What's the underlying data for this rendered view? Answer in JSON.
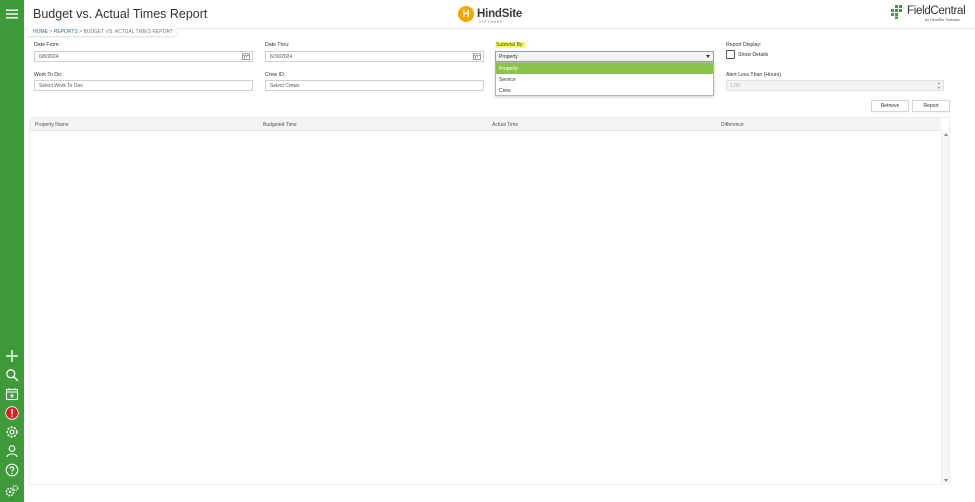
{
  "header": {
    "title": "Budget vs. Actual Times Report",
    "brand_center": {
      "name": "HindSite",
      "mark": "H",
      "sub": "SOFTWARE"
    },
    "brand_right": {
      "name": "FieldCentral",
      "sub": "by HindSite Software"
    }
  },
  "breadcrumb": {
    "home": "HOME",
    "sep1": " > ",
    "reports": "REPORTS",
    "sep2": " > ",
    "current": "BUDGET VS. ACTUAL TIMES REPORT"
  },
  "form": {
    "date_from": {
      "label": "Date From:",
      "value": "6/8/2024"
    },
    "date_thru": {
      "label": "Date Thru:",
      "value": "6/30/2024"
    },
    "subtotal_by": {
      "label": "Subtotal By:",
      "value": "Property",
      "options": [
        "Property",
        "Service",
        "Crew"
      ],
      "selected_index": 0
    },
    "report_display": {
      "label": "Report Display:",
      "show_details_label": "Show Details",
      "checked": false
    },
    "work_to_do": {
      "label": "Work To Do:",
      "placeholder": "Select Work To Dos"
    },
    "crew_id": {
      "label": "Crew ID:",
      "placeholder": "Select Crews"
    },
    "alert_less_than": {
      "label": "Alert Less Than (Hours)",
      "value": "1.00"
    }
  },
  "buttons": {
    "retrieve": "Retrieve",
    "report": "Report"
  },
  "table": {
    "columns": [
      "Property Name",
      "Budgeted Time",
      "Actual Time",
      "Difference"
    ],
    "rows": []
  },
  "colors": {
    "sidebar": "#3f9b3a",
    "selected_option": "#8bc34a",
    "highlight": "#ffff66",
    "hindsite_accent": "#f7a700"
  },
  "sidebar_icons": [
    "menu-icon",
    "add-icon",
    "search-icon",
    "calendar-icon",
    "alert-icon",
    "gear-icon",
    "user-icon",
    "help-icon",
    "gears-icon"
  ]
}
